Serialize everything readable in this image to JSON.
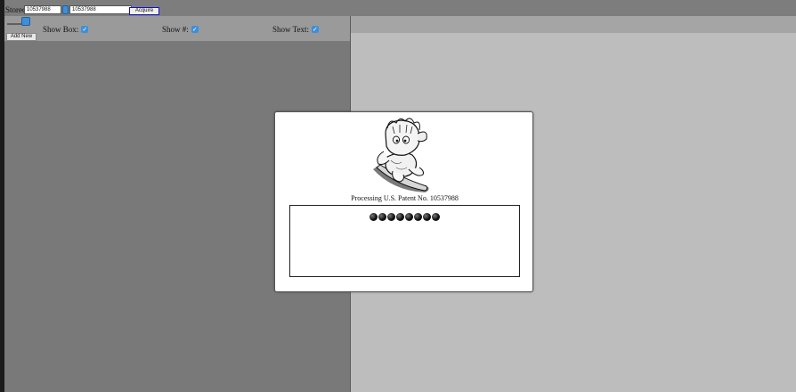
{
  "toolbar": {
    "stored_label": "Stored:",
    "stored_value": "10537988",
    "patent_value": "10537988",
    "acquire_label": "Acquire"
  },
  "controls": {
    "show_box_label": "Show Box:",
    "show_box_checked": true,
    "show_number_label": "Show #:",
    "show_number_checked": true,
    "show_text_label": "Show Text:",
    "show_text_checked": true,
    "add_new_label": "Add New"
  },
  "modal": {
    "status_text": "Processing U.S. Patent No. 10537988",
    "progress_dots": 8,
    "mascot_icon": "cartoon-mascot-image"
  },
  "colors": {
    "accent": "#3e8fd8",
    "left_panel": "#797979",
    "right_panel": "#bdbdbd",
    "acquire_border": "#1111cc"
  }
}
